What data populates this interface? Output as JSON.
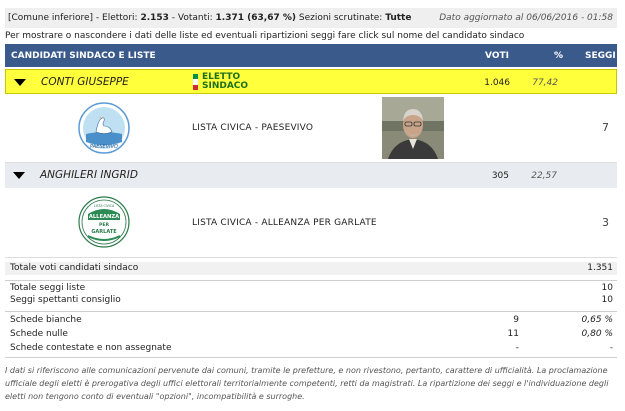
{
  "topbar": {
    "comune": "[Comune inferiore]",
    "elettori_label": "- Elettori:",
    "elettori": "2.153",
    "votanti_label": "- Votanti:",
    "votanti": "1.371 (63,67 %)",
    "sezioni_label": "Sezioni scrutinate:",
    "sezioni": "Tutte",
    "aggiornato": "Dato aggiornato al 06/06/2016 - 01:58"
  },
  "note": "Per mostrare o nascondere i dati delle liste ed eventuali ripartizioni seggi fare click sul nome del candidato sindaco",
  "header": {
    "col_candidati": "CANDIDATI SINDACO E LISTE",
    "col_voti": "VOTI",
    "col_perc": "%",
    "col_seggi": "SEGGI"
  },
  "candidates": [
    {
      "name": "CONTI GIUSEPPE",
      "status_line1": "ELETTO",
      "status_line2": "SINDACO",
      "voti": "1.046",
      "perc": "77,42",
      "lista": {
        "name": "LISTA CIVICA - PAESEVIVO",
        "seggi": "7",
        "logo_text": "PAESEVIVO"
      }
    },
    {
      "name": "ANGHILERI INGRID",
      "voti": "305",
      "perc": "22,57",
      "lista": {
        "name": "LISTA CIVICA - ALLEANZA PER GARLATE",
        "seggi": "3",
        "logo_top": "LISTA CIVICA",
        "logo_line1": "ALLEANZA",
        "logo_line2": "PER",
        "logo_line3": "GARLATE"
      }
    }
  ],
  "totals": {
    "tot_voti_label": "Totale voti candidati sindaco",
    "tot_voti": "1.351",
    "tot_seggi_label": "Totale seggi liste",
    "tot_seggi": "10",
    "seggi_consiglio_label": "Seggi spettanti consiglio",
    "seggi_consiglio": "10",
    "bianche_label": "Schede bianche",
    "bianche": "9",
    "bianche_perc": "0,65 %",
    "nulle_label": "Schede nulle",
    "nulle": "11",
    "nulle_perc": "0,80 %",
    "contestate_label": "Schede contestate e non assegnate",
    "contestate": "-",
    "contestate_perc": "-"
  },
  "footer": "I dati si riferiscono alle comunicazioni pervenute dai comuni, tramite le prefetture, e non rivestono, pertanto, carattere di ufficialità. La proclamazione ufficiale degli eletti è prerogativa degli uffici elettorali territorialmente competenti, retti da magistrati. La ripartizione dei seggi e l'individuazione degli eletti non tengono conto di eventuali \"opzioni\", incompatibilità e surroghe.",
  "colors": {
    "header_bg": "#3a5a8c",
    "eletto_bg": "#ffff3b",
    "eletto_text": "#1d6f1d"
  }
}
